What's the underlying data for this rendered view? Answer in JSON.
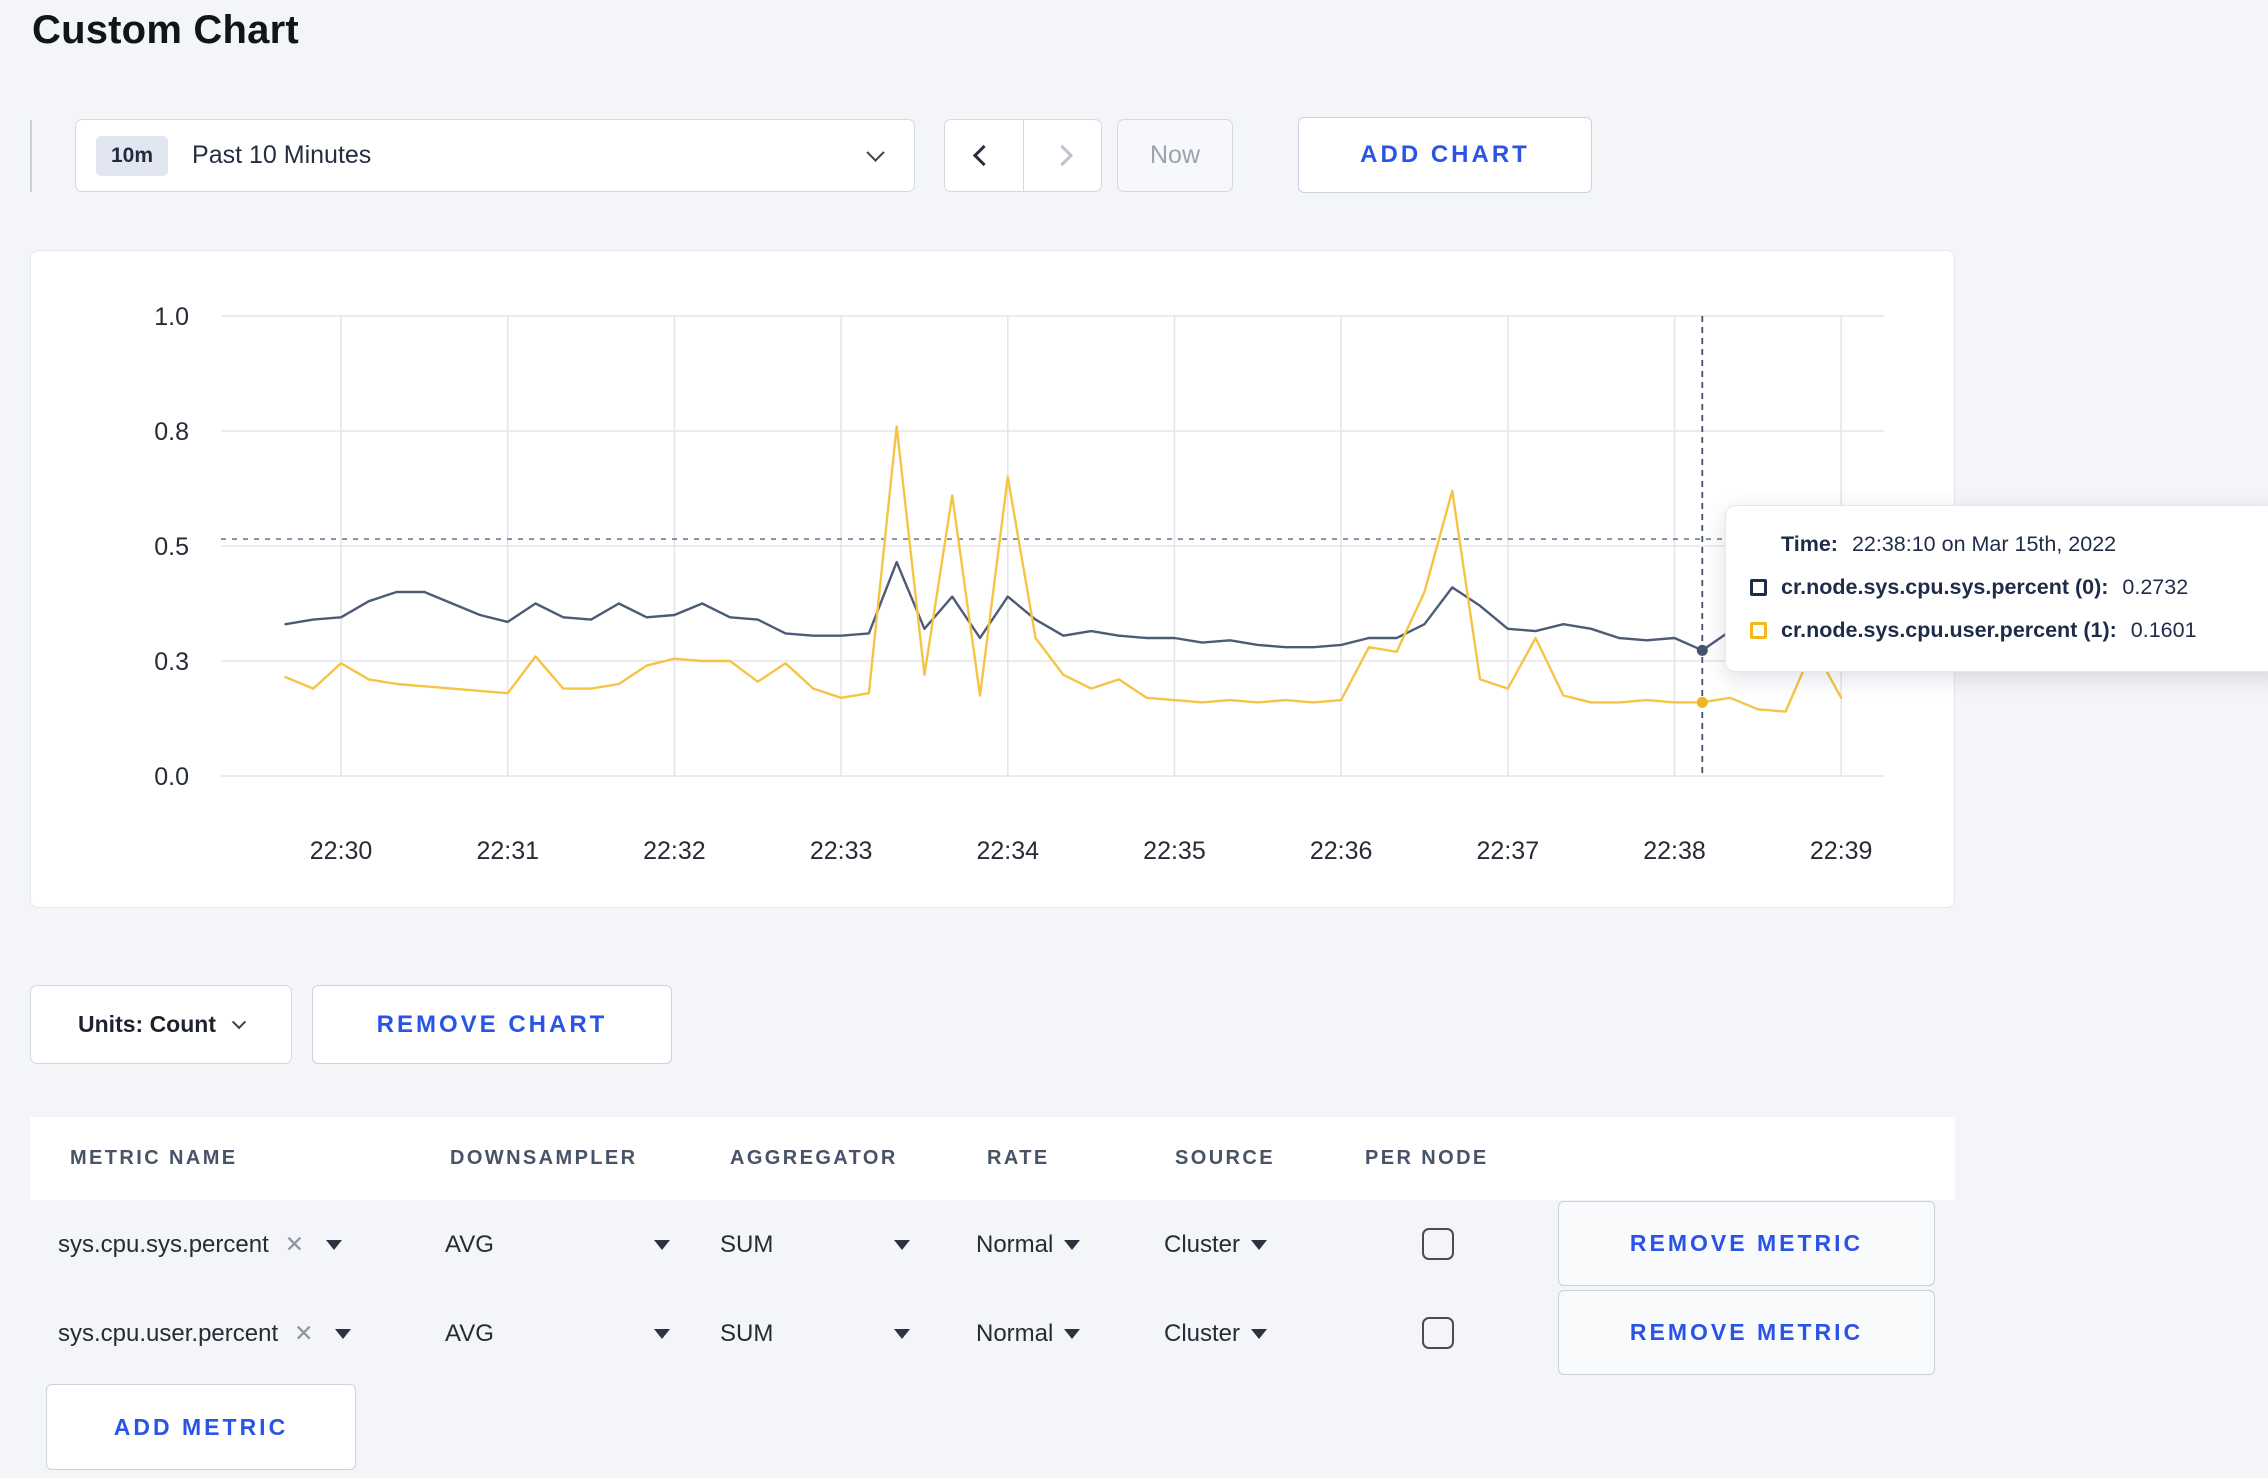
{
  "page": {
    "title": "Custom Chart"
  },
  "toolbar": {
    "time_window": {
      "badge": "10m",
      "label": "Past 10 Minutes"
    },
    "now_label": "Now",
    "add_chart_label": "ADD CHART"
  },
  "chart_data": {
    "type": "line",
    "title": "",
    "xlabel": "",
    "ylabel": "",
    "x_start": "22:29:40",
    "interval_seconds": 10,
    "x_ticks": [
      "22:30",
      "22:31",
      "22:32",
      "22:33",
      "22:34",
      "22:35",
      "22:36",
      "22:37",
      "22:38",
      "22:39"
    ],
    "y_ticks": {
      "labels": [
        "0.0",
        "0.3",
        "0.5",
        "0.8",
        "1.0"
      ],
      "values": [
        0,
        0.25,
        0.5,
        0.75,
        1.0
      ]
    },
    "ylim": [
      0,
      1.0
    ],
    "grid": true,
    "legend_position": "tooltip",
    "series": [
      {
        "name": "cr.node.sys.cpu.sys.percent (0)",
        "color": "#4d5b77",
        "dot_color": "#46536f",
        "values": [
          0.33,
          0.34,
          0.345,
          0.38,
          0.4,
          0.4,
          0.375,
          0.35,
          0.335,
          0.375,
          0.345,
          0.34,
          0.375,
          0.345,
          0.35,
          0.375,
          0.345,
          0.34,
          0.31,
          0.305,
          0.305,
          0.31,
          0.465,
          0.32,
          0.39,
          0.3,
          0.39,
          0.34,
          0.305,
          0.315,
          0.305,
          0.3,
          0.3,
          0.29,
          0.295,
          0.285,
          0.28,
          0.28,
          0.285,
          0.3,
          0.3,
          0.33,
          0.41,
          0.37,
          0.32,
          0.315,
          0.33,
          0.32,
          0.3,
          0.295,
          0.3,
          0.2732,
          0.315,
          0.33,
          0.315,
          0.3,
          0.295
        ]
      },
      {
        "name": "cr.node.sys.cpu.user.percent (1)",
        "color": "#f6c445",
        "dot_color": "#f0b425",
        "values": [
          0.215,
          0.19,
          0.245,
          0.21,
          0.2,
          0.195,
          0.19,
          0.185,
          0.18,
          0.26,
          0.19,
          0.19,
          0.2,
          0.24,
          0.255,
          0.25,
          0.25,
          0.205,
          0.245,
          0.19,
          0.17,
          0.18,
          0.76,
          0.22,
          0.61,
          0.175,
          0.65,
          0.3,
          0.22,
          0.19,
          0.21,
          0.17,
          0.165,
          0.16,
          0.165,
          0.16,
          0.165,
          0.16,
          0.165,
          0.28,
          0.27,
          0.4,
          0.62,
          0.21,
          0.19,
          0.3,
          0.175,
          0.16,
          0.16,
          0.165,
          0.16,
          0.1601,
          0.17,
          0.145,
          0.14,
          0.28,
          0.17
        ]
      }
    ],
    "crosshair": {
      "time": "22:38:10",
      "time_index": 51,
      "hline_value": 0.515
    }
  },
  "tooltip": {
    "time_label": "Time:",
    "time_value": "22:38:10 on Mar 15th, 2022",
    "series": [
      {
        "name": "cr.node.sys.cpu.sys.percent (0):",
        "value": "0.2732",
        "swatch": "#1d2c47"
      },
      {
        "name": "cr.node.sys.cpu.user.percent (1):",
        "value": "0.1601",
        "swatch": "#f5b818"
      }
    ]
  },
  "chart_footer": {
    "units_label": "Units: Count",
    "remove_chart_label": "REMOVE CHART"
  },
  "table": {
    "headers": [
      "METRIC NAME",
      "DOWNSAMPLER",
      "AGGREGATOR",
      "RATE",
      "SOURCE",
      "PER NODE"
    ],
    "rows": [
      {
        "metric": "sys.cpu.sys.percent",
        "downsampler": "AVG",
        "aggregator": "SUM",
        "rate": "Normal",
        "source": "Cluster",
        "per_node": false
      },
      {
        "metric": "sys.cpu.user.percent",
        "downsampler": "AVG",
        "aggregator": "SUM",
        "rate": "Normal",
        "source": "Cluster",
        "per_node": false
      }
    ],
    "remove_metric_label": "REMOVE METRIC",
    "add_metric_label": "ADD METRIC"
  }
}
